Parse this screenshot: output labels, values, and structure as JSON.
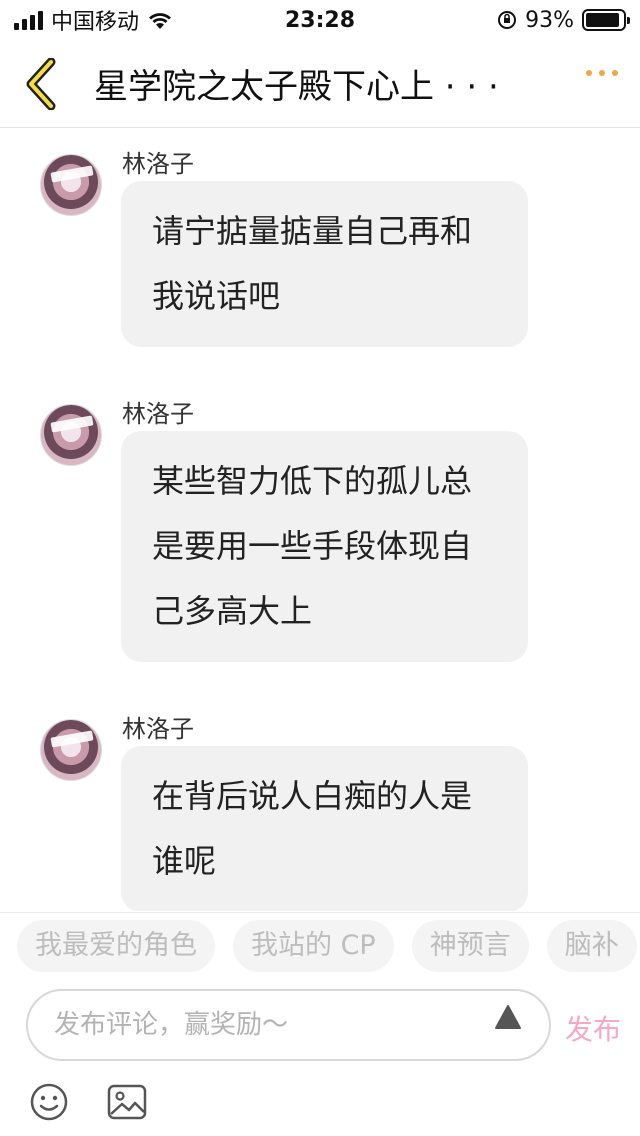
{
  "status_bar": {
    "carrier": "中国移动",
    "time": "23:28",
    "battery": "93%",
    "battery_level": 0.93,
    "icons": [
      "signal-icon",
      "wifi-icon",
      "orientation-lock-icon",
      "battery-icon"
    ]
  },
  "header": {
    "title": "星学院之太子殿下心上 · · ·",
    "back_icon": "chevron-left-icon",
    "more_icon": "more-dots-icon",
    "accent_color": "#f1a54a"
  },
  "messages": [
    {
      "sender": "林洛子",
      "text": "请宁掂量掂量自己再和我说话吧"
    },
    {
      "sender": "林洛子",
      "text": "某些智力低下的孤儿总是要用一些手段体现自己多高大上"
    },
    {
      "sender": "林洛子",
      "text": "在背后说人白痴的人是谁呢"
    }
  ],
  "chips": [
    "我最爱的角色",
    "我站的 CP",
    "神预言",
    "脑补"
  ],
  "composer": {
    "placeholder": "发布评论，赢奖励～",
    "send_label": "发布",
    "send_color": "#f5a9c4"
  },
  "toolbar": {
    "icons": [
      "emoji-icon",
      "image-icon"
    ]
  }
}
